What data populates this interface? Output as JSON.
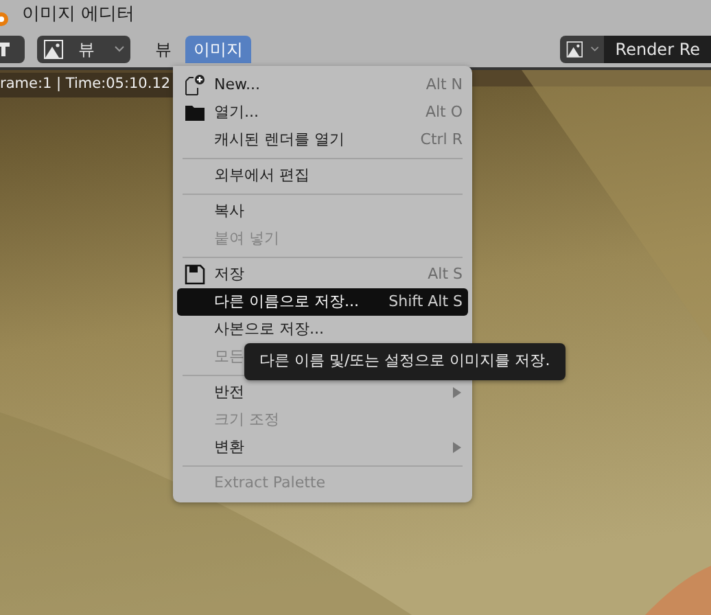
{
  "window": {
    "title": "이미지 에디터"
  },
  "header": {
    "view_dropdown": {
      "label": "뷰"
    },
    "menus": [
      {
        "label": "뷰",
        "selected": false
      },
      {
        "label": "이미지",
        "selected": true
      }
    ],
    "image_field": {
      "value": "Render Re"
    }
  },
  "viewport": {
    "info": "rame:1 | Time:05:10.12",
    "kind": "picture"
  },
  "menu": {
    "items": [
      {
        "kind": "new",
        "label": "New...",
        "shortcut": "Alt N",
        "disabled": false,
        "selected": false,
        "submenu": false
      },
      {
        "kind": "folder",
        "label": "열기...",
        "shortcut": "Alt O",
        "disabled": false,
        "selected": false,
        "submenu": false
      },
      {
        "kind": "plain",
        "label": "캐시된 렌더를 열기",
        "shortcut": "Ctrl R",
        "disabled": false,
        "selected": false,
        "submenu": false
      },
      {
        "kind": "separator"
      },
      {
        "kind": "plain",
        "label": "외부에서 편집",
        "disabled": false,
        "selected": false,
        "submenu": false
      },
      {
        "kind": "separator"
      },
      {
        "kind": "plain",
        "label": "복사",
        "disabled": false,
        "selected": false,
        "submenu": false
      },
      {
        "kind": "plain",
        "label": "붙여 넣기",
        "disabled": true,
        "selected": false,
        "submenu": false
      },
      {
        "kind": "separator"
      },
      {
        "kind": "save",
        "label": "저장",
        "shortcut": "Alt S",
        "disabled": false,
        "selected": false,
        "submenu": false
      },
      {
        "kind": "plain",
        "label": "다른 이름으로 저장...",
        "shortcut": "Shift Alt S",
        "disabled": false,
        "selected": true,
        "submenu": false
      },
      {
        "kind": "plain",
        "label": "사본으로 저장...",
        "disabled": false,
        "selected": false,
        "submenu": false
      },
      {
        "kind": "plain",
        "label": "모든",
        "disabled": true,
        "selected": false,
        "submenu": false
      },
      {
        "kind": "separator"
      },
      {
        "kind": "plain",
        "label": "반전",
        "disabled": false,
        "selected": false,
        "submenu": true
      },
      {
        "kind": "plain",
        "label": "크기 조정",
        "disabled": true,
        "selected": false,
        "submenu": false
      },
      {
        "kind": "plain",
        "label": "변환",
        "disabled": false,
        "selected": false,
        "submenu": true
      },
      {
        "kind": "separator"
      },
      {
        "kind": "plain",
        "label": "Extract Palette",
        "disabled": true,
        "selected": false,
        "submenu": false
      }
    ]
  },
  "tooltip": {
    "text": "다른 이름 및/또는 설정으로 이미지를 저장."
  }
}
